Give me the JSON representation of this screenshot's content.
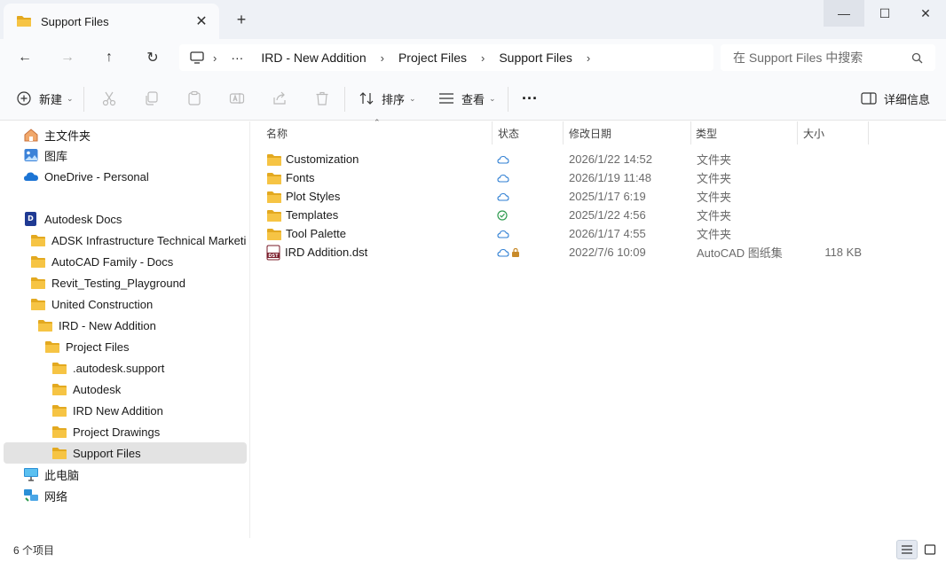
{
  "tab": {
    "title": "Support Files",
    "close_glyph": "✕"
  },
  "new_tab_glyph": "+",
  "window_controls": {
    "minimize": "—",
    "maximize": "☐",
    "close": "✕"
  },
  "nav": {
    "back_glyph": "←",
    "forward_glyph": "→",
    "up_glyph": "↑",
    "refresh_glyph": "↻"
  },
  "address": {
    "more_glyph": "···",
    "crumbs": [
      "IRD - New Addition",
      "Project Files",
      "Support Files"
    ],
    "sep_glyph": "›"
  },
  "search": {
    "placeholder": "在 Support Files 中搜索"
  },
  "toolbar": {
    "new_label": "新建",
    "sort_label": "排序",
    "view_label": "查看",
    "more_glyph": "···",
    "details_label": "详细信息"
  },
  "sidebar": {
    "home": "主文件夹",
    "gallery": "图库",
    "onedrive": "OneDrive - Personal",
    "autodesk_docs": "Autodesk Docs",
    "tree": [
      {
        "label": "ADSK Infrastructure Technical Marketing"
      },
      {
        "label": "AutoCAD Family - Docs"
      },
      {
        "label": "Revit_Testing_Playground"
      },
      {
        "label": "United Construction"
      },
      {
        "label": "IRD - New Addition"
      },
      {
        "label": "Project Files"
      },
      {
        "label": ".autodesk.support"
      },
      {
        "label": "Autodesk"
      },
      {
        "label": "IRD New Addition"
      },
      {
        "label": "Project Drawings"
      },
      {
        "label": "Support Files"
      }
    ],
    "this_pc": "此电脑",
    "network": "网络"
  },
  "columns": {
    "name": "名称",
    "status": "状态",
    "modified": "修改日期",
    "type": "类型",
    "size": "大小"
  },
  "files": [
    {
      "name": "Customization",
      "status": "cloud",
      "modified": "2026/1/22 14:52",
      "type": "文件夹",
      "size": ""
    },
    {
      "name": "Fonts",
      "status": "cloud",
      "modified": "2026/1/19 11:48",
      "type": "文件夹",
      "size": ""
    },
    {
      "name": "Plot Styles",
      "status": "cloud",
      "modified": "2025/1/17 6:19",
      "type": "文件夹",
      "size": ""
    },
    {
      "name": "Templates",
      "status": "synced",
      "modified": "2025/1/22 4:56",
      "type": "文件夹",
      "size": ""
    },
    {
      "name": "Tool Palette",
      "status": "cloud",
      "modified": "2026/1/17 4:55",
      "type": "文件夹",
      "size": ""
    },
    {
      "name": "IRD Addition.dst",
      "status": "cloud-locked",
      "modified": "2022/7/6 10:09",
      "type": "AutoCAD 图纸集",
      "size": "118 KB"
    }
  ],
  "dst_icon_text": "DST",
  "status": {
    "item_count": "6 个项目"
  },
  "colors": {
    "folder": "#f6c444",
    "folder_dark": "#e3a920",
    "accent": "#0067c0",
    "cloud": "#2f7fd3",
    "synced": "#2e9b4f",
    "selected": "#e3e3e3"
  }
}
